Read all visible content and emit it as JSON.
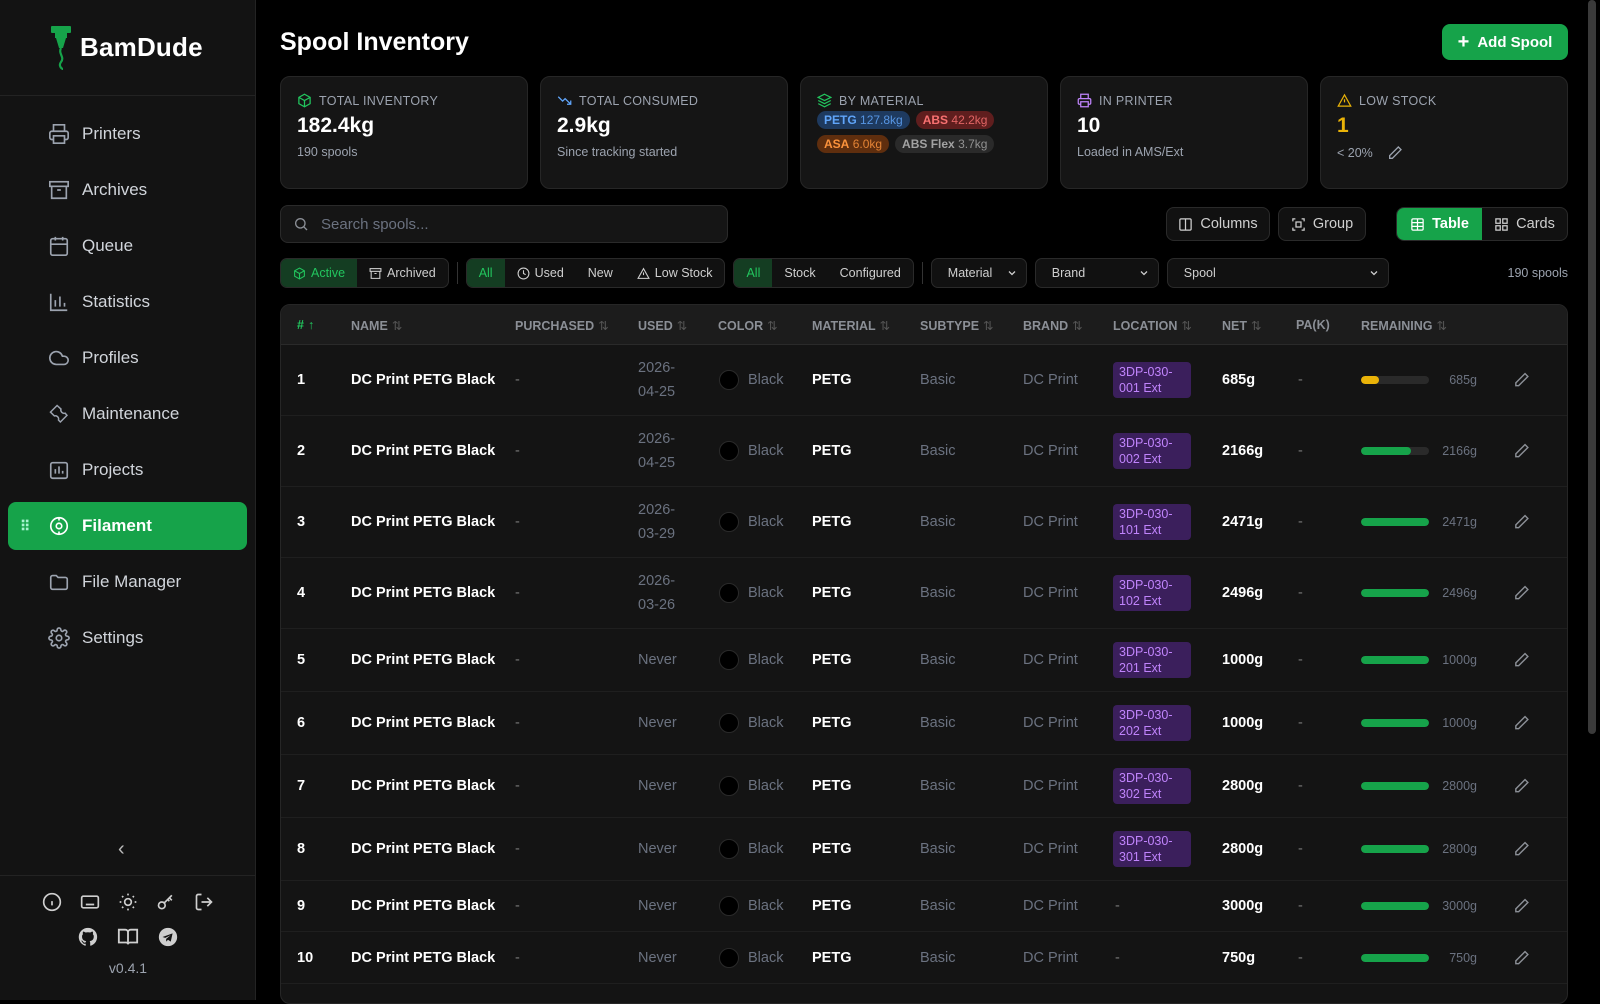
{
  "app": {
    "name": "BamDude",
    "version": "v0.4.1"
  },
  "nav": [
    {
      "label": "Printers",
      "icon": "printer-icon",
      "active": false
    },
    {
      "label": "Archives",
      "icon": "archive-icon",
      "active": false
    },
    {
      "label": "Queue",
      "icon": "calendar-icon",
      "active": false
    },
    {
      "label": "Statistics",
      "icon": "bar-chart-icon",
      "active": false
    },
    {
      "label": "Profiles",
      "icon": "cloud-icon",
      "active": false
    },
    {
      "label": "Maintenance",
      "icon": "wrench-icon",
      "active": false
    },
    {
      "label": "Projects",
      "icon": "project-icon",
      "active": false
    },
    {
      "label": "Filament",
      "icon": "spool-icon",
      "active": true
    },
    {
      "label": "File Manager",
      "icon": "folder-icon",
      "active": false
    },
    {
      "label": "Settings",
      "icon": "gear-icon",
      "active": false
    }
  ],
  "page": {
    "title": "Spool Inventory",
    "add_label": "Add Spool"
  },
  "stats": {
    "total_inventory": {
      "label": "Total Inventory",
      "value": "182.4kg",
      "sub": "190 spools"
    },
    "total_consumed": {
      "label": "Total Consumed",
      "value": "2.9kg",
      "sub": "Since tracking started"
    },
    "by_material": {
      "label": "By Material",
      "pills": [
        {
          "name": "PETG",
          "amount": "127.8kg",
          "bg": "#1e3a5f",
          "color": "#60a5fa"
        },
        {
          "name": "ABS",
          "amount": "42.2kg",
          "bg": "#5f1e1e",
          "color": "#f87171"
        },
        {
          "name": "ASA",
          "amount": "6.0kg",
          "bg": "#5f2e0e",
          "color": "#fb923c"
        },
        {
          "name": "ABS Flex",
          "amount": "3.7kg",
          "bg": "#2a2a2a",
          "color": "#a3a3a3"
        }
      ]
    },
    "in_printer": {
      "label": "In Printer",
      "value": "10",
      "sub": "Loaded in AMS/Ext"
    },
    "low_stock": {
      "label": "Low Stock",
      "value": "1",
      "sub": "< 20%"
    }
  },
  "search": {
    "placeholder": "Search spools..."
  },
  "view": {
    "columns": "Columns",
    "group": "Group",
    "table": "Table",
    "cards": "Cards"
  },
  "filters": {
    "status": [
      "Active",
      "Archived"
    ],
    "usage": [
      "All",
      "Used",
      "New",
      "Low Stock"
    ],
    "stock": [
      "All",
      "Stock",
      "Configured"
    ],
    "material": "Material",
    "brand": "Brand",
    "spool": "Spool",
    "count": "190 spools"
  },
  "columns": [
    "#",
    "Name",
    "Purchased",
    "Used",
    "Color",
    "Material",
    "Subtype",
    "Brand",
    "Location",
    "Net",
    "PA(K)",
    "Remaining"
  ],
  "rows": [
    {
      "num": "1",
      "name": "DC Print PETG Black",
      "purchased": "-",
      "used1": "2026-",
      "used2": "04-25",
      "color": "Black",
      "material": "PETG",
      "subtype": "Basic",
      "brand": "DC Print",
      "loc1": "3DP-030-",
      "loc2": "001 Ext",
      "net": "685g",
      "pa": "-",
      "remaining": 0.27,
      "rem_text": "685g",
      "bar_color": "#eab308"
    },
    {
      "num": "2",
      "name": "DC Print PETG Black",
      "purchased": "-",
      "used1": "2026-",
      "used2": "04-25",
      "color": "Black",
      "material": "PETG",
      "subtype": "Basic",
      "brand": "DC Print",
      "loc1": "3DP-030-",
      "loc2": "002 Ext",
      "net": "2166g",
      "pa": "-",
      "remaining": 0.74,
      "rem_text": "2166g",
      "bar_color": "#16a34a"
    },
    {
      "num": "3",
      "name": "DC Print PETG Black",
      "purchased": "-",
      "used1": "2026-",
      "used2": "03-29",
      "color": "Black",
      "material": "PETG",
      "subtype": "Basic",
      "brand": "DC Print",
      "loc1": "3DP-030-",
      "loc2": "101 Ext",
      "net": "2471g",
      "pa": "-",
      "remaining": 1.0,
      "rem_text": "2471g",
      "bar_color": "#16a34a"
    },
    {
      "num": "4",
      "name": "DC Print PETG Black",
      "purchased": "-",
      "used1": "2026-",
      "used2": "03-26",
      "color": "Black",
      "material": "PETG",
      "subtype": "Basic",
      "brand": "DC Print",
      "loc1": "3DP-030-",
      "loc2": "102 Ext",
      "net": "2496g",
      "pa": "-",
      "remaining": 1.0,
      "rem_text": "2496g",
      "bar_color": "#16a34a"
    },
    {
      "num": "5",
      "name": "DC Print PETG Black",
      "purchased": "-",
      "used1": "Never",
      "used2": "",
      "color": "Black",
      "material": "PETG",
      "subtype": "Basic",
      "brand": "DC Print",
      "loc1": "3DP-030-",
      "loc2": "201 Ext",
      "net": "1000g",
      "pa": "-",
      "remaining": 1.0,
      "rem_text": "1000g",
      "bar_color": "#16a34a"
    },
    {
      "num": "6",
      "name": "DC Print PETG Black",
      "purchased": "-",
      "used1": "Never",
      "used2": "",
      "color": "Black",
      "material": "PETG",
      "subtype": "Basic",
      "brand": "DC Print",
      "loc1": "3DP-030-",
      "loc2": "202 Ext",
      "net": "1000g",
      "pa": "-",
      "remaining": 1.0,
      "rem_text": "1000g",
      "bar_color": "#16a34a"
    },
    {
      "num": "7",
      "name": "DC Print PETG Black",
      "purchased": "-",
      "used1": "Never",
      "used2": "",
      "color": "Black",
      "material": "PETG",
      "subtype": "Basic",
      "brand": "DC Print",
      "loc1": "3DP-030-",
      "loc2": "302 Ext",
      "net": "2800g",
      "pa": "-",
      "remaining": 1.0,
      "rem_text": "2800g",
      "bar_color": "#16a34a"
    },
    {
      "num": "8",
      "name": "DC Print PETG Black",
      "purchased": "-",
      "used1": "Never",
      "used2": "",
      "color": "Black",
      "material": "PETG",
      "subtype": "Basic",
      "brand": "DC Print",
      "loc1": "3DP-030-",
      "loc2": "301 Ext",
      "net": "2800g",
      "pa": "-",
      "remaining": 1.0,
      "rem_text": "2800g",
      "bar_color": "#16a34a"
    },
    {
      "num": "9",
      "name": "DC Print PETG Black",
      "purchased": "-",
      "used1": "Never",
      "used2": "",
      "color": "Black",
      "material": "PETG",
      "subtype": "Basic",
      "brand": "DC Print",
      "loc1": "-",
      "loc2": "",
      "net": "3000g",
      "pa": "-",
      "remaining": 1.0,
      "rem_text": "3000g",
      "bar_color": "#16a34a"
    },
    {
      "num": "10",
      "name": "DC Print PETG Black",
      "purchased": "-",
      "used1": "Never",
      "used2": "",
      "color": "Black",
      "material": "PETG",
      "subtype": "Basic",
      "brand": "DC Print",
      "loc1": "-",
      "loc2": "",
      "net": "750g",
      "pa": "-",
      "remaining": 1.0,
      "rem_text": "750g",
      "bar_color": "#16a34a"
    }
  ]
}
